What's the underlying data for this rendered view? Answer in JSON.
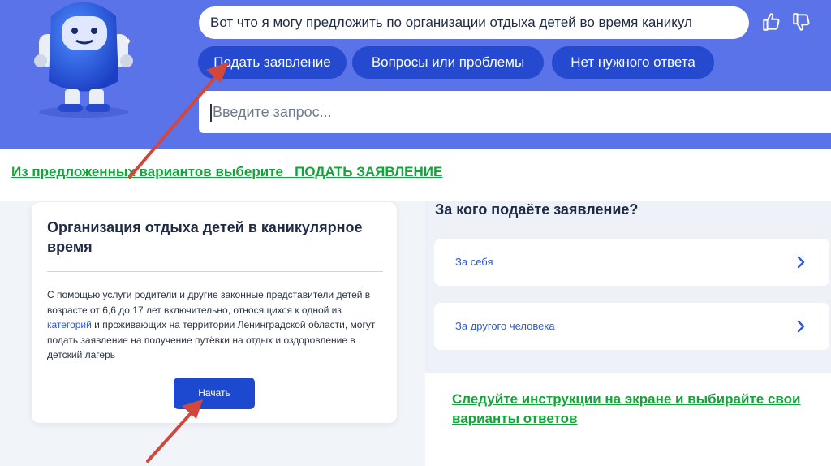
{
  "chat": {
    "message": "Вот что я могу предложить по организации отдыха детей во время каникул",
    "quick_replies": [
      "Подать заявление",
      "Вопросы или проблемы",
      "Нет нужного ответа"
    ],
    "query_placeholder": "Введите запрос...",
    "thumb_up_icon": "thumb-up-icon",
    "thumb_down_icon": "thumb-down-icon"
  },
  "instructions": {
    "first": "Из предложенных вариантов выберите   ПОДАТЬ ЗАЯВЛЕНИЕ",
    "second": "Следуйте инструкции на экране и выбирайте свои варианты ответов"
  },
  "service_card": {
    "title": "Организация отдыха детей в каникулярное время",
    "desc_before": "С помощью услуги родители и другие законные представители детей в возрасте от 6,6 до 17 лет включительно, относящихся к одной из ",
    "desc_link": "категорий",
    "desc_after": " и проживающих на территории Ленинградской области, могут подать заявление на получение путёвки на отдых и оздоровление в детский лагерь",
    "start_button": "Начать"
  },
  "applicant": {
    "title": "За кого подаёте заявление?",
    "options": [
      "За себя",
      "За другого человека"
    ]
  },
  "colors": {
    "band": "#5b73e8",
    "chip": "#2549cf",
    "instruction_green": "#17a33b",
    "arrow_red": "#d2473c",
    "link_blue": "#2c5bd6"
  }
}
